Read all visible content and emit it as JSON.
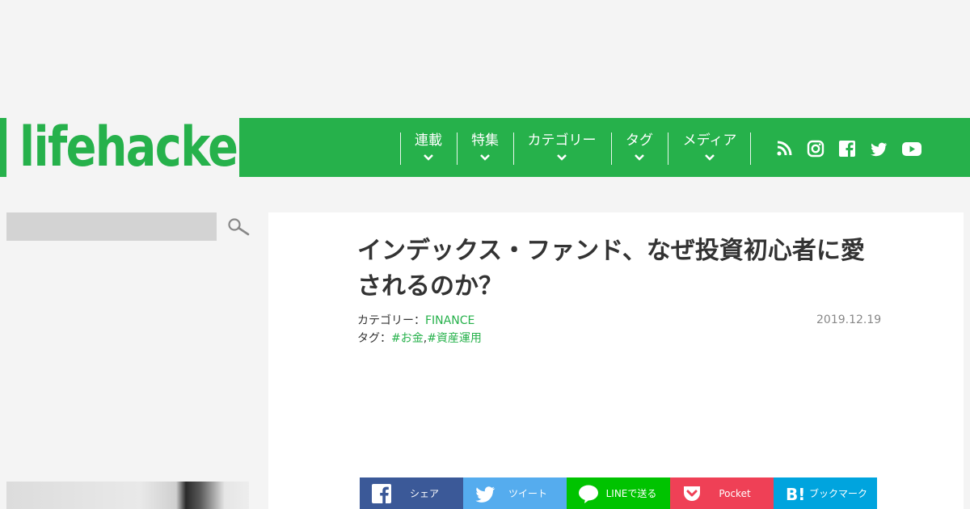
{
  "logo": {
    "text": "lifehacker"
  },
  "nav": {
    "items": [
      {
        "label": "連載"
      },
      {
        "label": "特集"
      },
      {
        "label": "カテゴリー"
      },
      {
        "label": "タグ"
      },
      {
        "label": "メディア"
      }
    ],
    "social": [
      "rss-icon",
      "instagram-icon",
      "facebook-icon",
      "twitter-icon",
      "youtube-icon"
    ]
  },
  "search": {
    "placeholder": ""
  },
  "article": {
    "title": "インデックス・ファンド、なぜ投資初心者に愛されるのか？",
    "category_label": "カテゴリー：",
    "category": "FINANCE",
    "tag_label": "タグ：",
    "tags": [
      "#お金",
      "#資産運用"
    ],
    "tag_sep": ",",
    "date": "2019.12.19"
  },
  "share": [
    {
      "label": "シェア",
      "color": "#3b5998",
      "icon": "facebook-icon"
    },
    {
      "label": "ツイート",
      "color": "#55acee",
      "icon": "twitter-icon"
    },
    {
      "label": "LINEで送る",
      "color": "#00c300",
      "icon": "line-icon"
    },
    {
      "label": "Pocket",
      "color": "#ef4056",
      "icon": "pocket-icon"
    },
    {
      "label": "ブックマーク",
      "color": "#00a4de",
      "icon": "hatena-bookmark-icon"
    }
  ],
  "colors": {
    "brand": "#26b14b",
    "background": "#f4f4f4"
  }
}
